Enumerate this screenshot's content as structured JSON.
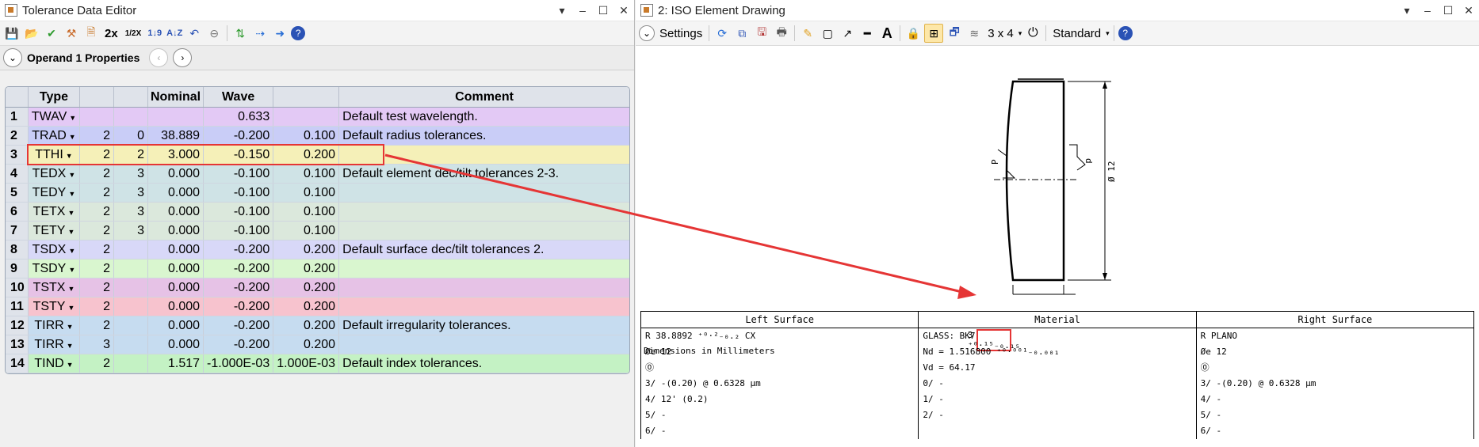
{
  "left": {
    "title": "Tolerance Data Editor",
    "toolbar": {
      "zoom2x": "2x",
      "zoomhalf": "1/2X"
    },
    "operand_bar": {
      "label": "Operand  1 Properties"
    },
    "columns": [
      "Type",
      "",
      "",
      "Nominal",
      "Wave",
      "",
      "Comment"
    ],
    "rows": [
      {
        "n": "1",
        "type": "TWAV",
        "c1": "",
        "c2": "",
        "nom": "",
        "wave": "0.633",
        "c5": "",
        "comment": "Default test wavelength.",
        "bg": "#e3c9f5"
      },
      {
        "n": "2",
        "type": "TRAD",
        "c1": "2",
        "c2": "0",
        "nom": "38.889",
        "wave": "-0.200",
        "c5": "0.100",
        "comment": "Default radius tolerances.",
        "bg": "#c9cdf7"
      },
      {
        "n": "3",
        "type": "TTHI",
        "c1": "2",
        "c2": "2",
        "nom": "3.000",
        "wave": "-0.150",
        "c5": "0.200",
        "comment": "",
        "bg": "#f5f0b8"
      },
      {
        "n": "4",
        "type": "TEDX",
        "c1": "2",
        "c2": "3",
        "nom": "0.000",
        "wave": "-0.100",
        "c5": "0.100",
        "comment": "Default element dec/tilt tolerances 2-3.",
        "bg": "#cfe3e6"
      },
      {
        "n": "5",
        "type": "TEDY",
        "c1": "2",
        "c2": "3",
        "nom": "0.000",
        "wave": "-0.100",
        "c5": "0.100",
        "comment": "",
        "bg": "#cfe3e6"
      },
      {
        "n": "6",
        "type": "TETX",
        "c1": "2",
        "c2": "3",
        "nom": "0.000",
        "wave": "-0.100",
        "c5": "0.100",
        "comment": "",
        "bg": "#dbe8dc"
      },
      {
        "n": "7",
        "type": "TETY",
        "c1": "2",
        "c2": "3",
        "nom": "0.000",
        "wave": "-0.100",
        "c5": "0.100",
        "comment": "",
        "bg": "#dbe8dc"
      },
      {
        "n": "8",
        "type": "TSDX",
        "c1": "2",
        "c2": "",
        "nom": "0.000",
        "wave": "-0.200",
        "c5": "0.200",
        "comment": "Default surface dec/tilt tolerances 2.",
        "bg": "#d8d8f8"
      },
      {
        "n": "9",
        "type": "TSDY",
        "c1": "2",
        "c2": "",
        "nom": "0.000",
        "wave": "-0.200",
        "c5": "0.200",
        "comment": "",
        "bg": "#d9f6cf"
      },
      {
        "n": "10",
        "type": "TSTX",
        "c1": "2",
        "c2": "",
        "nom": "0.000",
        "wave": "-0.200",
        "c5": "0.200",
        "comment": "",
        "bg": "#e6c2e6"
      },
      {
        "n": "11",
        "type": "TSTY",
        "c1": "2",
        "c2": "",
        "nom": "0.000",
        "wave": "-0.200",
        "c5": "0.200",
        "comment": "",
        "bg": "#f7c3ce"
      },
      {
        "n": "12",
        "type": "TIRR",
        "c1": "2",
        "c2": "",
        "nom": "0.000",
        "wave": "-0.200",
        "c5": "0.200",
        "comment": "Default irregularity tolerances.",
        "bg": "#c6dcf0"
      },
      {
        "n": "13",
        "type": "TIRR",
        "c1": "3",
        "c2": "",
        "nom": "0.000",
        "wave": "-0.200",
        "c5": "0.200",
        "comment": "",
        "bg": "#c6dcf0"
      },
      {
        "n": "14",
        "type": "TIND",
        "c1": "2",
        "c2": "",
        "nom": "1.517",
        "wave": "-1.000E-03",
        "c5": "1.000E-03",
        "comment": "Default index tolerances.",
        "bg": "#c4f2c4"
      }
    ]
  },
  "right": {
    "title": "2: ISO Element Drawing",
    "toolbar": {
      "settings": "Settings",
      "layout": "3 x 4",
      "style": "Standard"
    },
    "drawing": {
      "dim_label": "Dimensions in Millimeters",
      "diameter": "Ø 12",
      "thick": "3 ⁺⁰·¹⁵₋₀.₁₅",
      "p_label": "P",
      "d_label": "d"
    },
    "spec": {
      "left_surface": {
        "head": "Left Surface",
        "lines": [
          "R 38.8892 ⁺⁰·²₋₀.₂  CX",
          "Øe 12",
          "⓪",
          "3/ -(0.20) @ 0.6328 μm",
          "4/ 12' (0.2)",
          "5/ -",
          "6/ -"
        ]
      },
      "material": {
        "head": "Material",
        "lines": [
          "GLASS: BK7",
          "  Nd = 1.516800 ⁺⁰·⁰⁰¹₋₀.₀₀₁",
          "  Vd = 64.17",
          "0/ -",
          "1/ -",
          "2/ -",
          ""
        ]
      },
      "right_surface": {
        "head": "Right Surface",
        "lines": [
          "R PLANO",
          "Øe 12",
          "⓪",
          "3/ -(0.20) @ 0.6328 μm",
          "4/ -",
          "5/ -",
          "6/ -"
        ]
      }
    }
  }
}
